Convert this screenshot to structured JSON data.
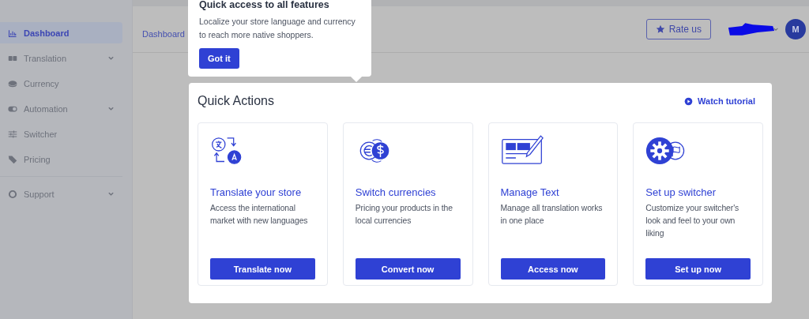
{
  "sidebar": {
    "items": [
      {
        "label": "Dashboard",
        "selected": true,
        "expandable": false
      },
      {
        "label": "Translation",
        "selected": false,
        "expandable": true
      },
      {
        "label": "Currency",
        "selected": false,
        "expandable": false
      },
      {
        "label": "Automation",
        "selected": false,
        "expandable": true
      },
      {
        "label": "Switcher",
        "selected": false,
        "expandable": false
      },
      {
        "label": "Pricing",
        "selected": false,
        "expandable": false
      },
      {
        "label": "Support",
        "selected": false,
        "expandable": true
      }
    ]
  },
  "header": {
    "breadcrumb": "Dashboard",
    "rate_button": "Rate us",
    "avatar": "M"
  },
  "tooltip": {
    "title": "Quick access to all features",
    "text": "Localize your store language and currency to reach more native shoppers.",
    "button": "Got it"
  },
  "quick_actions": {
    "title": "Quick Actions",
    "tutorial_link": "Watch tutorial",
    "cards": [
      {
        "title": "Translate your store",
        "description": "Access the international market with new languages",
        "button": "Translate now"
      },
      {
        "title": "Switch currencies",
        "description": "Pricing your products in the local currencies",
        "button": "Convert now"
      },
      {
        "title": "Manage Text",
        "description": "Manage all translation works in one place",
        "button": "Access now"
      },
      {
        "title": "Set up switcher",
        "description": "Customize your switcher's look and feel to your own liking",
        "button": "Set up now"
      }
    ]
  }
}
